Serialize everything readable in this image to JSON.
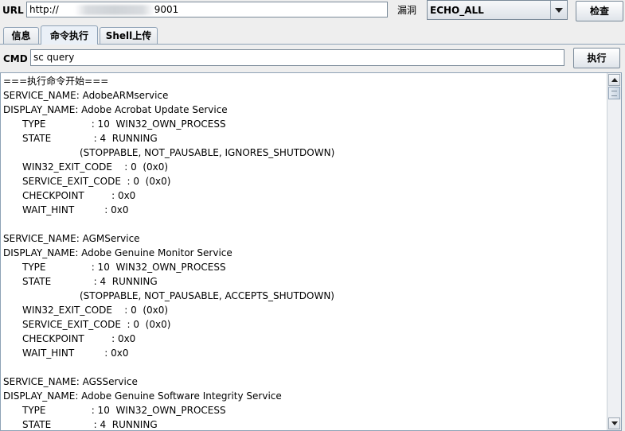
{
  "toolbar": {
    "url_label": "URL",
    "url_visible_prefix": "http://",
    "url_visible_suffix": "9001",
    "vuln_label": "漏洞",
    "vuln_selected": "ECHO_ALL",
    "check_button": "检查"
  },
  "tabs": [
    {
      "label": "信息",
      "active": false
    },
    {
      "label": "命令执行",
      "active": true
    },
    {
      "label": "Shell上传",
      "active": false
    }
  ],
  "cmd": {
    "label": "CMD",
    "value": "sc query",
    "execute_button": "执行"
  },
  "output": {
    "header": "===执行命令开始===",
    "services": [
      {
        "service_name": "SERVICE_NAME: AdobeARMservice",
        "display_name": "DISPLAY_NAME: Adobe Acrobat Update Service",
        "type": "TYPE               : 10  WIN32_OWN_PROCESS",
        "state": "STATE              : 4  RUNNING",
        "state_flags": "(STOPPABLE, NOT_PAUSABLE, IGNORES_SHUTDOWN)",
        "win32_exit_code": "WIN32_EXIT_CODE    : 0  (0x0)",
        "service_exit_code": "SERVICE_EXIT_CODE  : 0  (0x0)",
        "checkpoint": "CHECKPOINT         : 0x0",
        "wait_hint": "WAIT_HINT          : 0x0"
      },
      {
        "service_name": "SERVICE_NAME: AGMService",
        "display_name": "DISPLAY_NAME: Adobe Genuine Monitor Service",
        "type": "TYPE               : 10  WIN32_OWN_PROCESS",
        "state": "STATE              : 4  RUNNING",
        "state_flags": "(STOPPABLE, NOT_PAUSABLE, ACCEPTS_SHUTDOWN)",
        "win32_exit_code": "WIN32_EXIT_CODE    : 0  (0x0)",
        "service_exit_code": "SERVICE_EXIT_CODE  : 0  (0x0)",
        "checkpoint": "CHECKPOINT         : 0x0",
        "wait_hint": "WAIT_HINT          : 0x0"
      },
      {
        "service_name": "SERVICE_NAME: AGSService",
        "display_name": "DISPLAY_NAME: Adobe Genuine Software Integrity Service",
        "type": "TYPE               : 10  WIN32_OWN_PROCESS",
        "state": "STATE              : 4  RUNNING"
      }
    ]
  }
}
